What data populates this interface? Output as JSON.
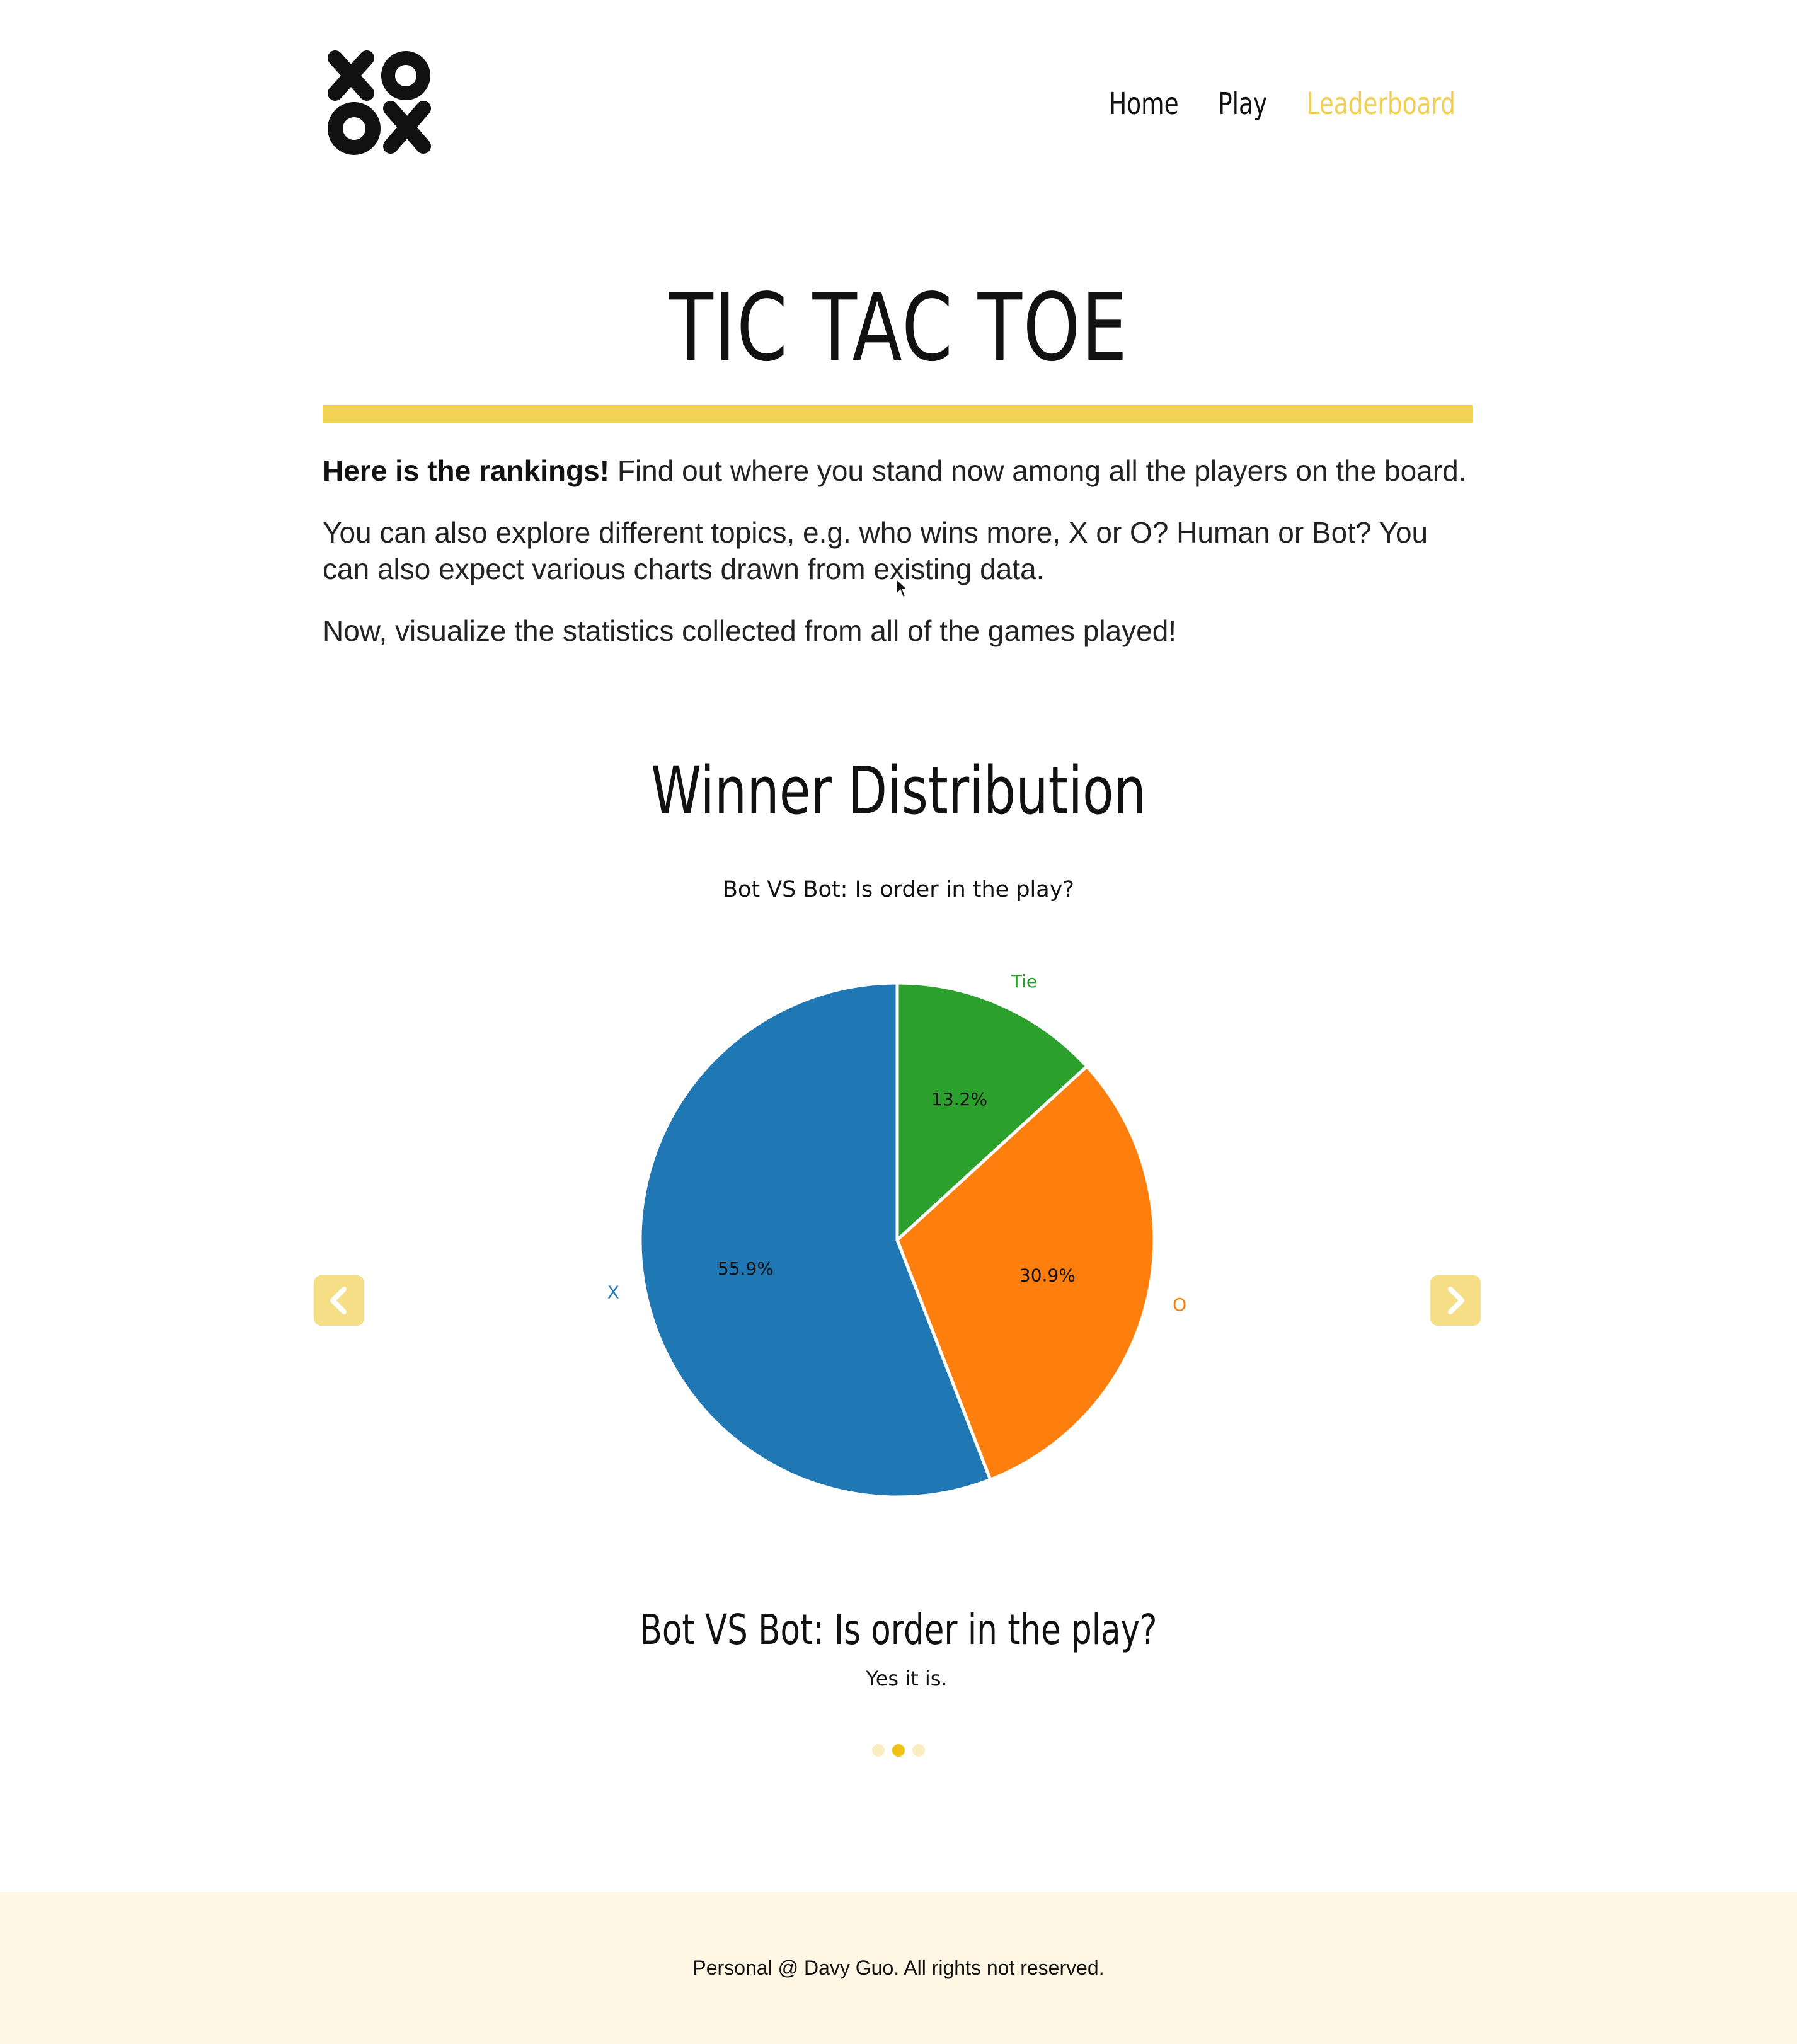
{
  "header": {
    "logo_alt": "XOOX",
    "nav": [
      {
        "label": "Home",
        "active": false
      },
      {
        "label": "Play",
        "active": false
      },
      {
        "label": "Leaderboard",
        "active": true
      }
    ]
  },
  "hero": {
    "title": "TIC TAC TOE",
    "intro_bold": "Here is the rankings!",
    "intro_rest": " Find out where you stand now among all the players on the board.",
    "paragraph_2": "You can also explore different topics, e.g. who wins more, X or O? Human or Bot? You can also expect various charts drawn from existing data.",
    "paragraph_3": "Now, visualize the statistics collected from all of the games played!"
  },
  "section": {
    "title": "Winner Distribution"
  },
  "chart_data": {
    "type": "pie",
    "title": "Bot VS Bot: Is order in the play?",
    "slices": [
      {
        "label": "Tie",
        "value": 13.2,
        "pct_label": "13.2%",
        "color": "#2ca02c"
      },
      {
        "label": "O",
        "value": 30.9,
        "pct_label": "30.9%",
        "color": "#ff7f0e"
      },
      {
        "label": "X",
        "value": 55.9,
        "pct_label": "55.9%",
        "color": "#1f77b4"
      }
    ],
    "start_angle_deg": 90,
    "direction": "clockwise"
  },
  "carousel": {
    "prev_icon": "chevron-left-icon",
    "next_icon": "chevron-right-icon",
    "caption_title": "Bot VS Bot: Is order in the play?",
    "caption_text": "Yes it is.",
    "slide_count": 3,
    "active_index": 1,
    "accent_color": "#f3d354"
  },
  "footer": {
    "text": "Personal @ Davy Guo.  All rights not reserved."
  }
}
